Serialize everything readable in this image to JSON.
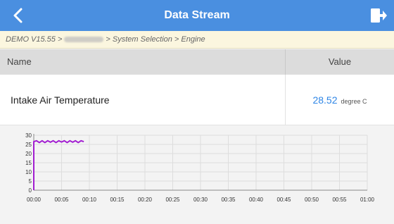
{
  "header": {
    "title": "Data Stream",
    "back_icon": "chevron-left-icon",
    "exit_icon": "exit-icon"
  },
  "breadcrumb": {
    "prefix": "DEMO V15.55 >",
    "suffix": "> System Selection > Engine"
  },
  "table": {
    "headers": {
      "name": "Name",
      "value": "Value"
    },
    "rows": [
      {
        "name": "Intake Air Temperature",
        "value": "28.52",
        "unit": "degree C"
      }
    ]
  },
  "colors": {
    "header": "#4a8fe0",
    "value": "#2f86e6",
    "line": "#a21ed1"
  },
  "chart_data": {
    "type": "line",
    "y_ticks": [
      "30",
      "25",
      "20",
      "15",
      "10",
      "5",
      "0"
    ],
    "x_ticks": [
      "00:00",
      "00:05",
      "00:10",
      "00:15",
      "00:20",
      "00:25",
      "00:30",
      "00:35",
      "00:40",
      "00:45",
      "00:50",
      "00:55",
      "01:00"
    ],
    "ylim": [
      0,
      30
    ],
    "xlim": [
      0,
      60
    ],
    "grid": true,
    "series": [
      {
        "x": [
          0,
          0,
          0.5,
          1,
          1.5,
          2,
          2.5,
          3,
          3.5,
          4,
          4.5,
          5,
          5.5,
          6,
          6.5,
          7,
          7.5,
          8,
          8.5,
          9
        ],
        "values": [
          0,
          26.5,
          27,
          26,
          27,
          26,
          27,
          26.2,
          27,
          26,
          27,
          26.3,
          27,
          26,
          27,
          26.2,
          27,
          26,
          27,
          26.5
        ]
      }
    ]
  }
}
